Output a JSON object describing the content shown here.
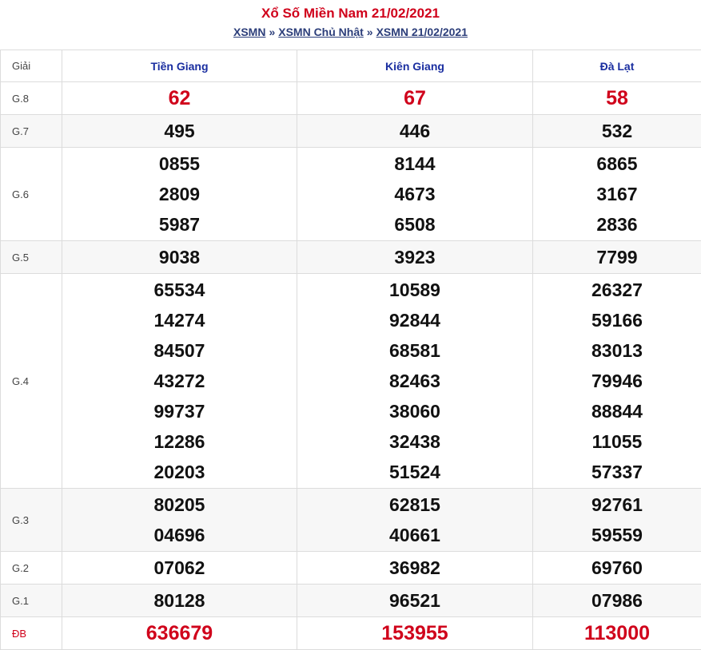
{
  "header": {
    "title": "Xổ Số Miền Nam 21/02/2021",
    "breadcrumb": [
      "XSMN",
      "XSMN Chủ Nhật",
      "XSMN 21/02/2021"
    ],
    "separator": "»"
  },
  "table": {
    "label_header": "Giải",
    "provinces": [
      "Tiền Giang",
      "Kiên Giang",
      "Đà Lạt"
    ],
    "rows": [
      {
        "label": "G.8",
        "values": [
          [
            "62"
          ],
          [
            "67"
          ],
          [
            "58"
          ]
        ]
      },
      {
        "label": "G.7",
        "values": [
          [
            "495"
          ],
          [
            "446"
          ],
          [
            "532"
          ]
        ]
      },
      {
        "label": "G.6",
        "values": [
          [
            "0855",
            "2809",
            "5987"
          ],
          [
            "8144",
            "4673",
            "6508"
          ],
          [
            "6865",
            "3167",
            "2836"
          ]
        ]
      },
      {
        "label": "G.5",
        "values": [
          [
            "9038"
          ],
          [
            "3923"
          ],
          [
            "7799"
          ]
        ]
      },
      {
        "label": "G.4",
        "values": [
          [
            "65534",
            "14274",
            "84507",
            "43272",
            "99737",
            "12286",
            "20203"
          ],
          [
            "10589",
            "92844",
            "68581",
            "82463",
            "38060",
            "32438",
            "51524"
          ],
          [
            "26327",
            "59166",
            "83013",
            "79946",
            "88844",
            "11055",
            "57337"
          ]
        ]
      },
      {
        "label": "G.3",
        "values": [
          [
            "80205",
            "04696"
          ],
          [
            "62815",
            "40661"
          ],
          [
            "92761",
            "59559"
          ]
        ]
      },
      {
        "label": "G.2",
        "values": [
          [
            "07062"
          ],
          [
            "36982"
          ],
          [
            "69760"
          ]
        ]
      },
      {
        "label": "G.1",
        "values": [
          [
            "80128"
          ],
          [
            "96521"
          ],
          [
            "07986"
          ]
        ]
      },
      {
        "label": "ĐB",
        "values": [
          [
            "636679"
          ],
          [
            "153955"
          ],
          [
            "113000"
          ]
        ]
      }
    ]
  }
}
